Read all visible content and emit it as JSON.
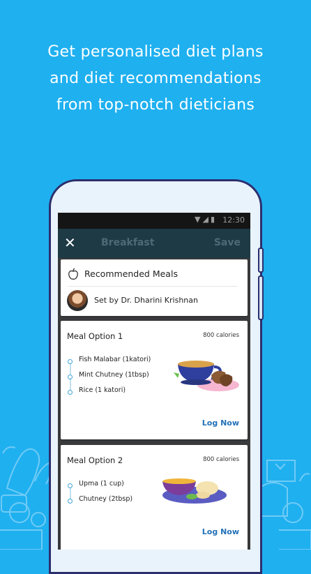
{
  "headline": {
    "line1": "Get personalised diet plans",
    "line2": "and diet recommendations",
    "line3": "from top-notch dieticians"
  },
  "status_bar": {
    "time": "12:30",
    "icons": [
      "wifi-icon",
      "signal-icon",
      "battery-icon"
    ]
  },
  "toolbar": {
    "close_icon": "close-icon",
    "title": "Breakfast",
    "save_label": "Save"
  },
  "recommended": {
    "icon": "apple-icon",
    "title": "Recommended Meals",
    "set_by": "Set by Dr. Dharini Krishnan"
  },
  "meals": [
    {
      "title": "Meal Option 1",
      "calories": "800 calories",
      "items": [
        "Fish Malabar (1katori)",
        "Mint Chutney (1tbsp)",
        "Rice (1 katori)"
      ],
      "action": "Log Now"
    },
    {
      "title": "Meal Option 2",
      "calories": "800 calories",
      "items": [
        "Upma (1 cup)",
        "Chutney (2tbsp)"
      ],
      "action": "Log Now"
    }
  ],
  "colors": {
    "background": "#1fb0f0",
    "accent": "#2271b8",
    "toolbar": "#1d3a45"
  }
}
